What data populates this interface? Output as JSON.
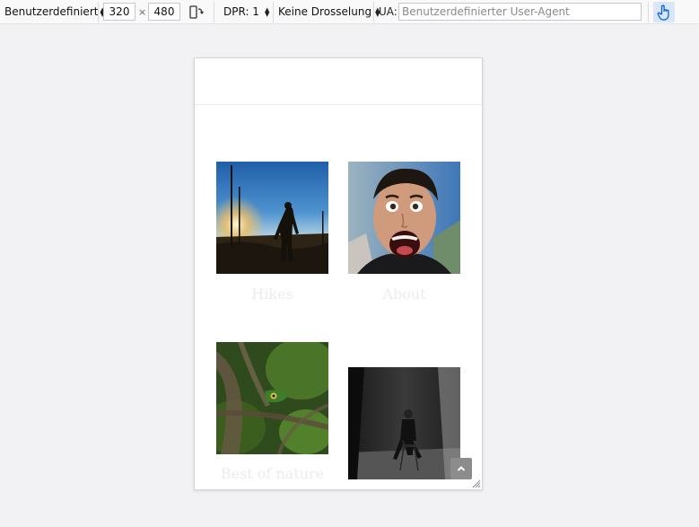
{
  "toolbar": {
    "device_preset": "Benutzerdefiniert",
    "width": "320",
    "times_sign": "×",
    "height": "480",
    "dpr_label": "DPR: 1",
    "throttle_label": "Keine Drosselung",
    "ua_label": "UA:",
    "ua_placeholder": "Benutzerdefinierter User-Agent"
  },
  "icons": {
    "rotate": "rotate-device-icon",
    "touch": "touch-simulation-icon",
    "scroll_top": "chevron-up-icon",
    "resize": "resize-grip-icon"
  },
  "colors": {
    "toolbar_bg": "#f9f9fa",
    "page_bg": "#f2f2f4",
    "touch_active": "#d9e6f8",
    "touch_icon": "#0a60d8",
    "caption": "#ececec"
  },
  "gallery": {
    "items": [
      {
        "caption": "Hikes",
        "image": "hiker-sunset-photo"
      },
      {
        "caption": "About",
        "image": "portrait-face-photo"
      },
      {
        "caption": "Best of nature",
        "image": "lizard-photo"
      },
      {
        "caption": "",
        "image": "studio-portrait-photo"
      }
    ]
  }
}
